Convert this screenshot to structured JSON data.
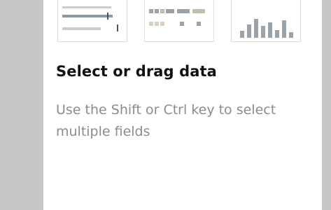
{
  "panel": {
    "title": "Select or drag data",
    "description": "Use the Shift or Ctrl key to select multiple fields"
  },
  "thumbnails": [
    {
      "icon": "bullet-bar-chart-icon"
    },
    {
      "icon": "highlight-table-icon"
    },
    {
      "icon": "column-chart-icon"
    }
  ],
  "colors": {
    "side_panel": "#c6c6c6",
    "thumb_gray": "#9aa3a9",
    "thumb_green": "#b5c4a6",
    "thumb_tan": "#d8cfc4",
    "text_muted": "#8c8c8c"
  }
}
